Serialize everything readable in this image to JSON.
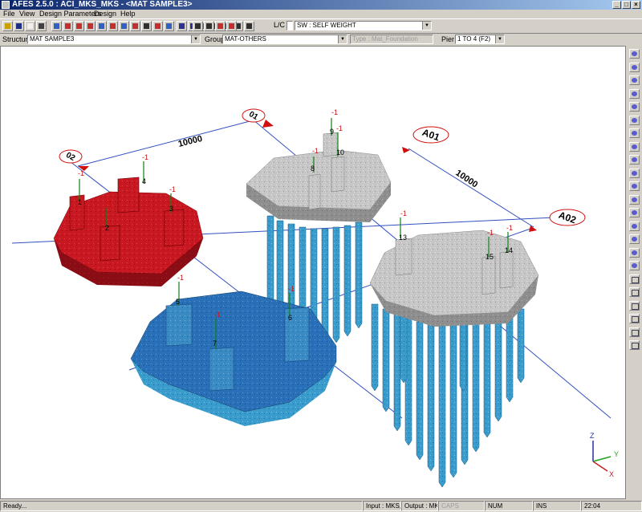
{
  "window": {
    "title": "AFES 2.5.0 : ACI_MKS_MKS - <MAT SAMPLE3>"
  },
  "menu": [
    "File",
    "View",
    "Design Parameters",
    "Design",
    "Help"
  ],
  "toolbar": {
    "lc_label": "L/C",
    "load_case": "SW : SELF WEIGHT",
    "buttons": [
      {
        "icon": "open-icon",
        "color": "#c8a000"
      },
      {
        "icon": "save-icon",
        "color": "#203080"
      },
      {
        "icon": "new-icon",
        "color": "#f0f0f0"
      },
      {
        "icon": "settings-icon",
        "color": "#404040"
      },
      {
        "icon": "grid-icon",
        "color": "#3060c0"
      },
      {
        "icon": "cut-icon",
        "color": "#c03030"
      },
      {
        "icon": "pier-icon",
        "color": "#c03030"
      },
      {
        "icon": "pier-add-icon",
        "color": "#c03030"
      },
      {
        "icon": "pile-icon",
        "color": "#3060c0"
      },
      {
        "icon": "pile-add-icon",
        "color": "#c03030"
      },
      {
        "icon": "load-icon",
        "color": "#3060c0"
      },
      {
        "icon": "beam-icon",
        "color": "#c03030"
      },
      {
        "icon": "axis-icon",
        "color": "#303030"
      },
      {
        "icon": "snap-icon",
        "color": "#c03030"
      },
      {
        "icon": "table-icon",
        "color": "#3060c0"
      },
      {
        "icon": "mesh-icon",
        "color": "#303090"
      },
      {
        "icon": "check-icon",
        "color": "#303090"
      },
      {
        "icon": "render-icon",
        "color": "#c03030"
      },
      {
        "icon": "rotate-icon",
        "color": "#303030"
      },
      {
        "icon": "view-icon",
        "color": "#303030"
      },
      {
        "icon": "zoom-icon",
        "color": "#303030"
      },
      {
        "icon": "report-icon",
        "color": "#303030"
      },
      {
        "icon": "print-icon",
        "color": "#303030"
      },
      {
        "icon": "design-icon",
        "color": "#303030"
      },
      {
        "icon": "stop-icon",
        "color": "#c03030"
      },
      {
        "icon": "flag-icon",
        "color": "#c03030"
      }
    ]
  },
  "selectors": {
    "structure_label": "Structure",
    "structure_value": "MAT SAMPLE3",
    "group_label": "Group",
    "group_value": "MAT-OTHERS",
    "type_value": "Type : Mat_Foundation",
    "pier_label": "Pier",
    "pier_value": "1 TO 4 (F2)"
  },
  "model": {
    "grid_labels": [
      "01",
      "02",
      "A01",
      "A02"
    ],
    "dimensions": [
      "10000",
      "10000"
    ],
    "node_labels": [
      "1",
      "2",
      "3",
      "4",
      "5",
      "6",
      "7",
      "8",
      "9",
      "10",
      "13",
      "14",
      "15"
    ],
    "load_marker": "-1",
    "axes": [
      "X",
      "Y",
      "Z"
    ],
    "colors": {
      "mat1": "#c81822",
      "mat2": "#2a70b8",
      "mat_gray": "#c4c4c4",
      "pile": "#3a9ccc",
      "grid_line": "#3050c0",
      "tag": "#d01010"
    }
  },
  "status": {
    "message": "Ready...",
    "input": "Input : MKS,",
    "output": "Output : MKS",
    "caps": "CAPS",
    "num": "NUM",
    "ins": "INS",
    "time": "22:04"
  }
}
